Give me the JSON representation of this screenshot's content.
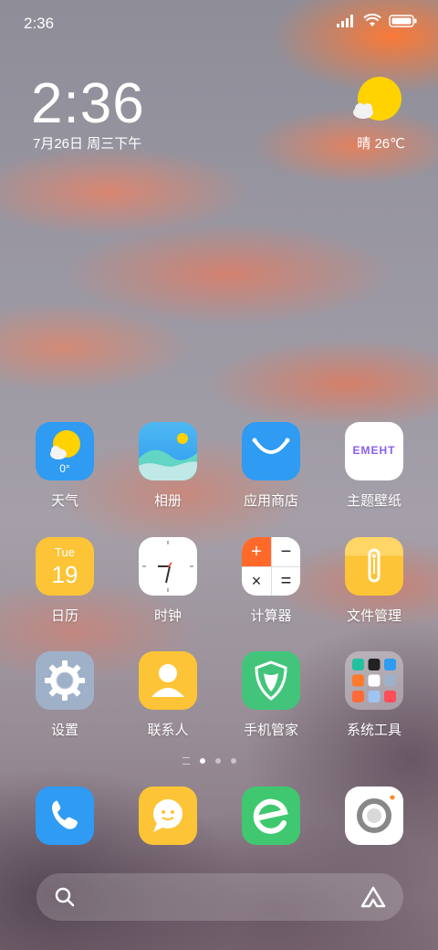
{
  "status_bar": {
    "time": "2:36"
  },
  "lockclock": {
    "time": "2:36",
    "date": "7月26日 周三下午"
  },
  "weather": {
    "condition": "晴",
    "temp": "26℃",
    "summary": "晴 26℃",
    "icon": "sun-cloud-icon"
  },
  "apps": [
    {
      "label": "天气",
      "icon": "weather-app-icon",
      "badge": "0°"
    },
    {
      "label": "相册",
      "icon": "gallery-app-icon"
    },
    {
      "label": "应用商店",
      "icon": "app-store-icon"
    },
    {
      "label": "主题壁纸",
      "icon": "themes-app-icon",
      "text": "EMEHT"
    },
    {
      "label": "日历",
      "icon": "calendar-app-icon",
      "day": "Tue",
      "date": "19"
    },
    {
      "label": "时钟",
      "icon": "clock-app-icon"
    },
    {
      "label": "计算器",
      "icon": "calculator-app-icon",
      "symbols": [
        "+",
        "−",
        "×",
        "="
      ]
    },
    {
      "label": "文件管理",
      "icon": "file-manager-icon"
    },
    {
      "label": "设置",
      "icon": "settings-app-icon"
    },
    {
      "label": "联系人",
      "icon": "contacts-app-icon"
    },
    {
      "label": "手机管家",
      "icon": "security-app-icon"
    },
    {
      "label": "系统工具",
      "icon": "system-tools-folder-icon"
    }
  ],
  "dock": [
    {
      "icon": "phone-app-icon"
    },
    {
      "icon": "messages-app-icon"
    },
    {
      "icon": "browser-app-icon"
    },
    {
      "icon": "camera-app-icon"
    }
  ],
  "pages": {
    "count": 3,
    "active": 1
  },
  "search": {
    "left_icon": "search-icon",
    "right_icon": "assistant-icon"
  },
  "colors": {
    "weather_blue": "#2f9bf2",
    "store_blue": "#2f9bf2",
    "calendar_yellow": "#fcc436",
    "settings_gray": "#9fb1c8",
    "contacts_yellow": "#fcc436",
    "security_green": "#42c57a",
    "phone_blue": "#2f9bf2",
    "browser_green": "#3fc86f"
  }
}
